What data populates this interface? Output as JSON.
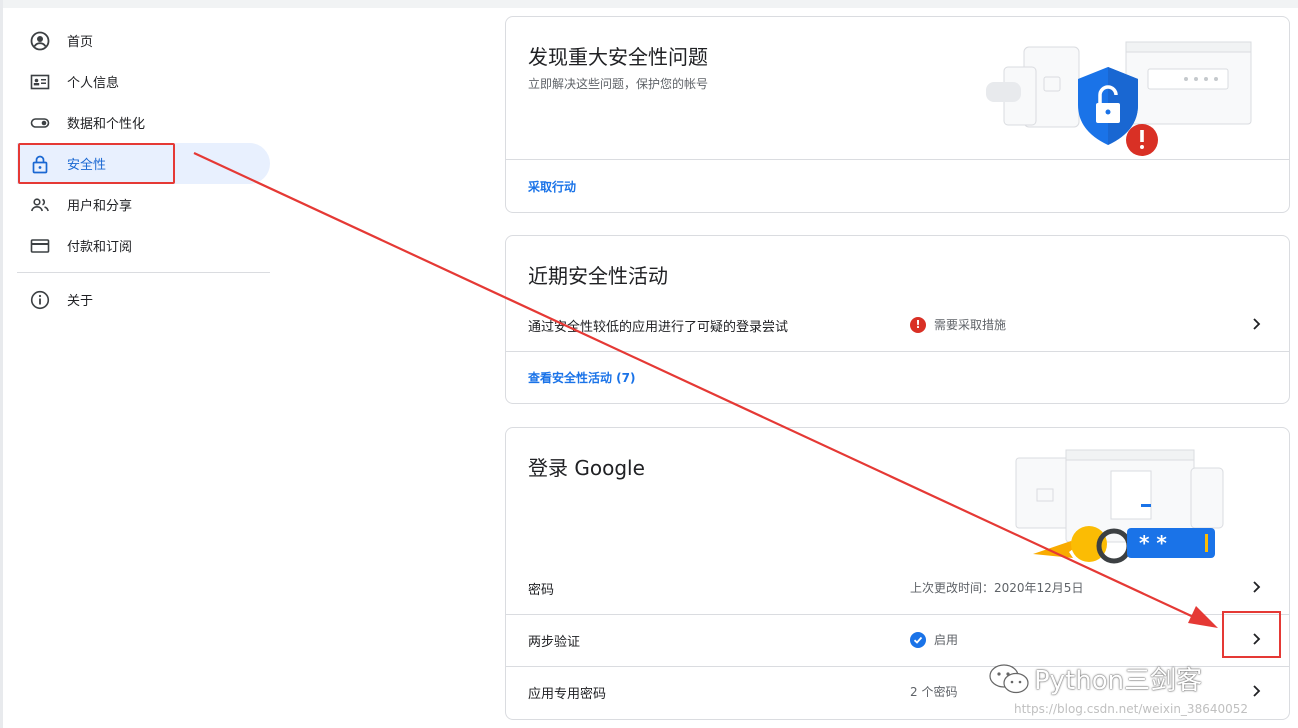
{
  "sidebar": {
    "items": [
      {
        "label": "首页",
        "icon": "account-circle-icon"
      },
      {
        "label": "个人信息",
        "icon": "id-card-icon"
      },
      {
        "label": "数据和个性化",
        "icon": "toggle-icon"
      },
      {
        "label": "安全性",
        "icon": "lock-icon"
      },
      {
        "label": "用户和分享",
        "icon": "people-icon"
      },
      {
        "label": "付款和订阅",
        "icon": "credit-card-icon"
      }
    ],
    "about": {
      "label": "关于",
      "icon": "info-icon"
    }
  },
  "issues_card": {
    "title": "发现重大安全性问题",
    "subtitle": "立即解决这些问题，保护您的帐号",
    "action": "采取行动"
  },
  "activity_card": {
    "title": "近期安全性活动",
    "row_label": "通过安全性较低的应用进行了可疑的登录尝试",
    "row_status": "需要采取措施",
    "link": "查看安全性活动 (7)"
  },
  "signin_card": {
    "title": "登录 Google",
    "rows": [
      {
        "label": "密码",
        "value": "上次更改时间：2020年12月5日"
      },
      {
        "label": "两步验证",
        "value": "启用"
      },
      {
        "label": "应用专用密码",
        "value": "2 个密码"
      }
    ]
  },
  "watermark": {
    "brand": "Python三剑客",
    "url": "https://blog.csdn.net/weixin_38640052"
  },
  "colors": {
    "accent": "#1a73e8",
    "alert": "#d93025",
    "annotation": "#e53935",
    "active_bg": "#e8f0fe"
  }
}
